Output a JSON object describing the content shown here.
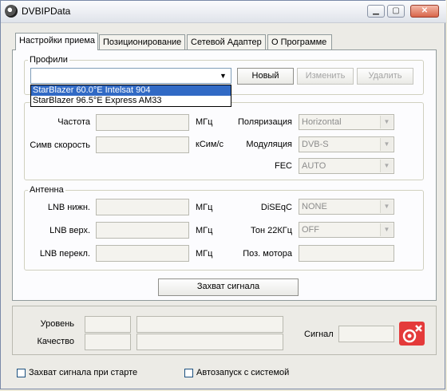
{
  "window": {
    "title": "DVBIPData"
  },
  "tabs": [
    "Настройки приема",
    "Позиционирование",
    "Сетевой Адаптер",
    "О Программе"
  ],
  "profiles": {
    "group_label": "Профили",
    "selected": "",
    "options": [
      "StarBlazer 60.0°E Intelsat 904",
      "StarBlazer 96.5°E Express AM33"
    ],
    "btn_new": "Новый",
    "btn_edit": "Изменить",
    "btn_delete": "Удалить"
  },
  "tuning": {
    "freq_label": "Частота",
    "freq_unit": "МГц",
    "symrate_label": "Симв скорость",
    "symrate_unit": "кСим/с",
    "pol_label": "Поляризация",
    "pol_value": "Horizontal",
    "mod_label": "Модуляция",
    "mod_value": "DVB-S",
    "fec_label": "FEC",
    "fec_value": "AUTO"
  },
  "antenna": {
    "group_label": "Антенна",
    "lnb_low_label": "LNB нижн.",
    "lnb_high_label": "LNB верх.",
    "lnb_switch_label": "LNB перекл.",
    "unit": "МГц",
    "diseqc_label": "DiSEqC",
    "diseqc_value": "NONE",
    "tone_label": "Тон 22КГц",
    "tone_value": "OFF",
    "motor_label": "Поз. мотора"
  },
  "capture_button": "Захват сигнала",
  "signal": {
    "level_label": "Уровень",
    "quality_label": "Качество",
    "signal_label": "Сигнал"
  },
  "options": {
    "capture_on_start": "Захват сигнала при старте",
    "autostart": "Автозапуск с системой"
  }
}
